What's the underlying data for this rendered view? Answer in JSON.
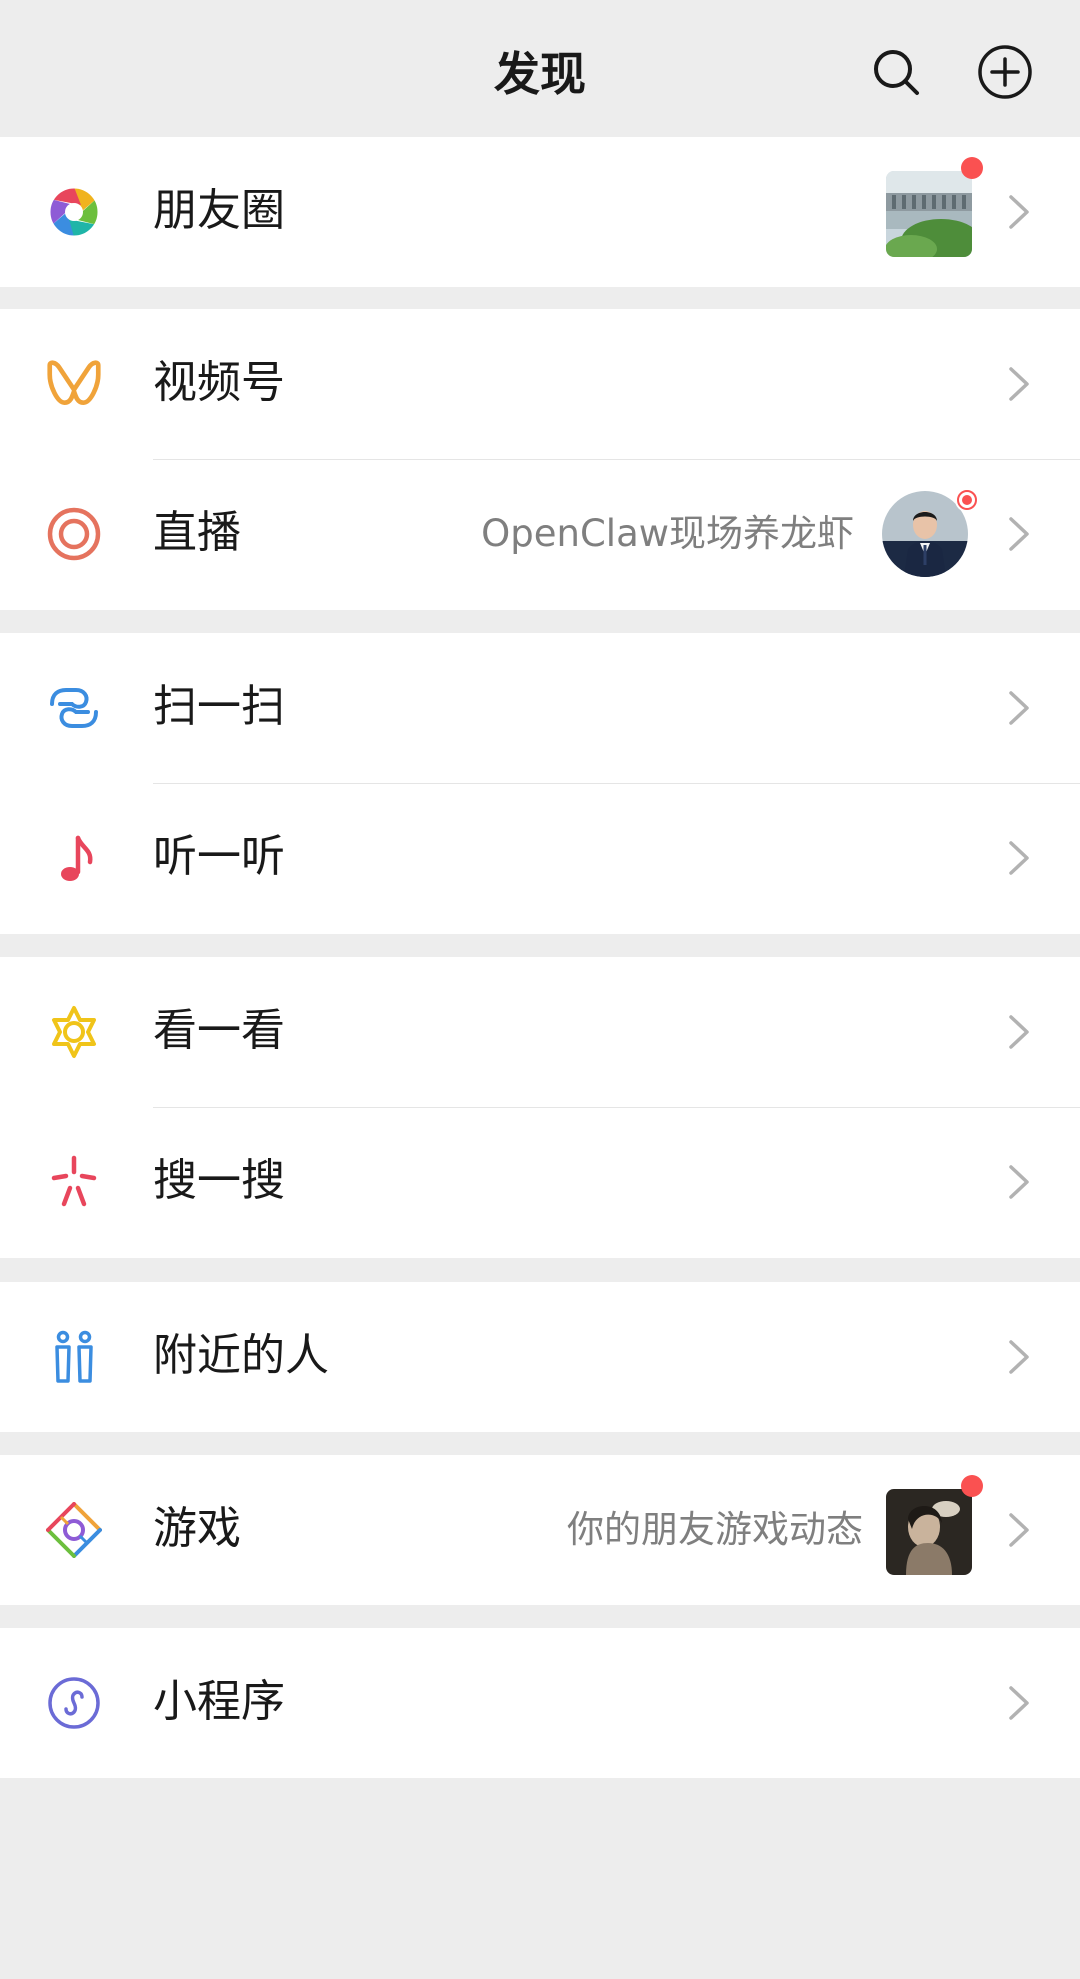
{
  "header": {
    "title": "发现",
    "search_icon": "search-icon",
    "add_icon": "plus-circle-icon"
  },
  "colors": {
    "background": "#ededed",
    "card": "#ffffff",
    "text": "#191919",
    "secondary_text": "#7f7f7f",
    "badge_red": "#fa5151",
    "chevron": "#b2b2b2"
  },
  "groups": [
    {
      "items": [
        {
          "label": "朋友圈",
          "icon": "moments-shutter-icon",
          "thumbnail": "landscape-photo",
          "badge": true
        }
      ]
    },
    {
      "items": [
        {
          "label": "视频号",
          "icon": "channels-icon"
        },
        {
          "label": "直播",
          "icon": "live-icon",
          "subtitle": "OpenClaw现场养龙虾",
          "avatar": "person-avatar",
          "badge": "live"
        }
      ]
    },
    {
      "items": [
        {
          "label": "扫一扫",
          "icon": "scan-icon"
        },
        {
          "label": "听一听",
          "icon": "music-note-icon"
        }
      ]
    },
    {
      "items": [
        {
          "label": "看一看",
          "icon": "top-stories-icon"
        },
        {
          "label": "搜一搜",
          "icon": "search-sparkle-icon"
        }
      ]
    },
    {
      "items": [
        {
          "label": "附近的人",
          "icon": "people-nearby-icon"
        }
      ]
    },
    {
      "items": [
        {
          "label": "游戏",
          "icon": "games-icon",
          "subtitle": "你的朋友游戏动态",
          "thumbnail": "game-photo",
          "badge": true
        }
      ]
    },
    {
      "items": [
        {
          "label": "小程序",
          "icon": "mini-programs-icon"
        }
      ]
    }
  ]
}
